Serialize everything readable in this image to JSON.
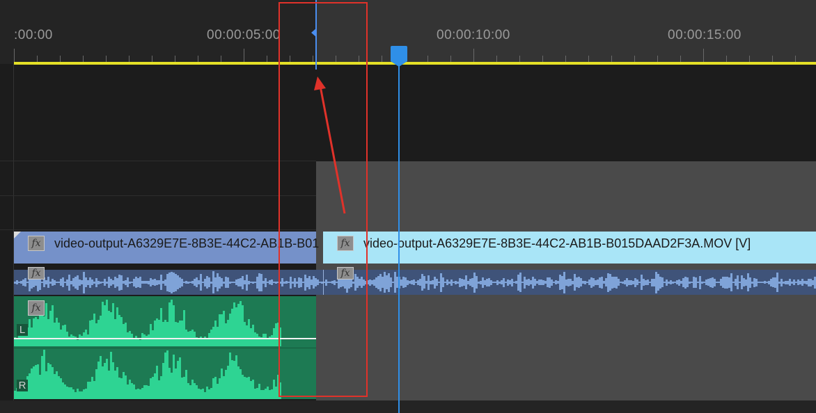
{
  "ruler": {
    "timecodes": [
      ":00:00",
      "00:00:05:00",
      "00:00:10:00",
      "00:00:15:00"
    ]
  },
  "tracks": {
    "video_clip_1": {
      "fx": "fx",
      "label": "video-output-A6329E7E-8B3E-44C2-AB1B-B01"
    },
    "video_clip_2": {
      "fx": "fx",
      "label": "video-output-A6329E7E-8B3E-44C2-AB1B-B015DAAD2F3A.MOV [V]"
    },
    "audio_strip_1": {
      "fx": "fx"
    },
    "audio_strip_2": {
      "fx": "fx"
    },
    "audio_clip": {
      "fx": "fx",
      "channel_left": "L",
      "channel_right": "R"
    }
  },
  "colors": {
    "playhead": "#2f8fe8",
    "work_area_bar": "#e4e027",
    "annotation": "#e0322a",
    "video_clip_selected": "#7591c9",
    "video_clip": "#a9e5f7",
    "audio_clip": "#1d7a53"
  },
  "icons": [
    "fx-badge-icon",
    "playhead-icon",
    "edit-point-marker-icon",
    "annotation-arrow-icon"
  ]
}
